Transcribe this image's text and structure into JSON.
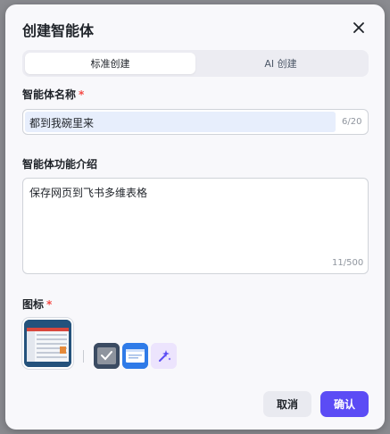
{
  "dialog": {
    "title": "创建智能体"
  },
  "tabs": [
    {
      "label": "标准创建",
      "active": true
    },
    {
      "label": "AI 创建",
      "active": false
    }
  ],
  "name_field": {
    "label": "智能体名称",
    "required_mark": "*",
    "value": "都到我碗里来",
    "counter": "6/20"
  },
  "desc_field": {
    "label": "智能体功能介绍",
    "value": "保存网页到飞书多维表格",
    "counter": "11/500"
  },
  "icon_field": {
    "label": "图标",
    "required_mark": "*"
  },
  "actions": {
    "cancel_label": "取消",
    "confirm_label": "确认"
  },
  "colors": {
    "accent": "#5b4cf5",
    "required": "#f54a45"
  }
}
